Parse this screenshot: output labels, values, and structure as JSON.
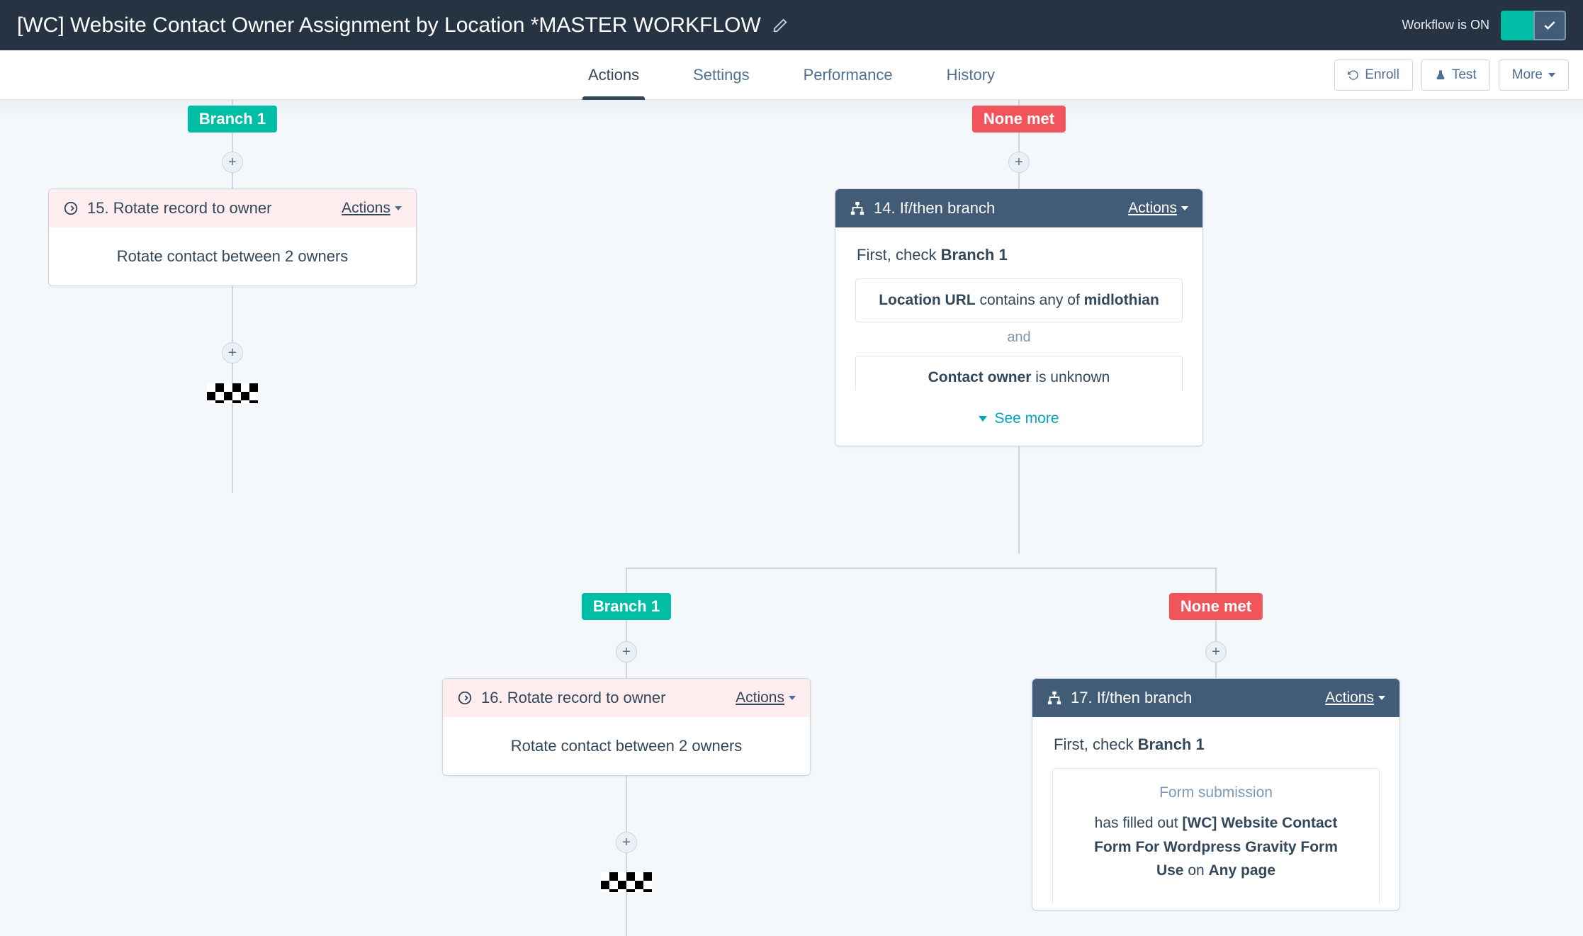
{
  "header": {
    "title": "[WC] Website Contact Owner Assignment by Location *MASTER WORKFLOW",
    "status": "Workflow is ON"
  },
  "tabs": {
    "actions": "Actions",
    "settings": "Settings",
    "performance": "Performance",
    "history": "History"
  },
  "toolbar": {
    "enroll": "Enroll",
    "test": "Test",
    "more": "More"
  },
  "labels": {
    "branch1": "Branch 1",
    "none_met": "None met",
    "actions": "Actions",
    "and": "and",
    "see_more": "See more",
    "first_check_prefix": "First, check ",
    "first_check_branch": "Branch 1",
    "form_submission": "Form submission",
    "has_filled_out": "has filled out ",
    "on_prefix": " on ",
    "any_page": "Any page"
  },
  "cards": {
    "rotate15": {
      "title": "15. Rotate record to owner",
      "body": "Rotate contact between 2 owners"
    },
    "rotate16": {
      "title": "16. Rotate record to owner",
      "body": "Rotate contact between 2 owners"
    },
    "branch14": {
      "title": "14. If/then branch",
      "crit1_field": "Location URL",
      "crit1_mid": " contains any of ",
      "crit1_value": "midlothian",
      "crit2_field": "Contact owner",
      "crit2_rest": " is unknown"
    },
    "branch17": {
      "title": "17. If/then branch",
      "form_name": "[WC] Website Contact Form For Wordpress Gravity Form Use"
    }
  }
}
